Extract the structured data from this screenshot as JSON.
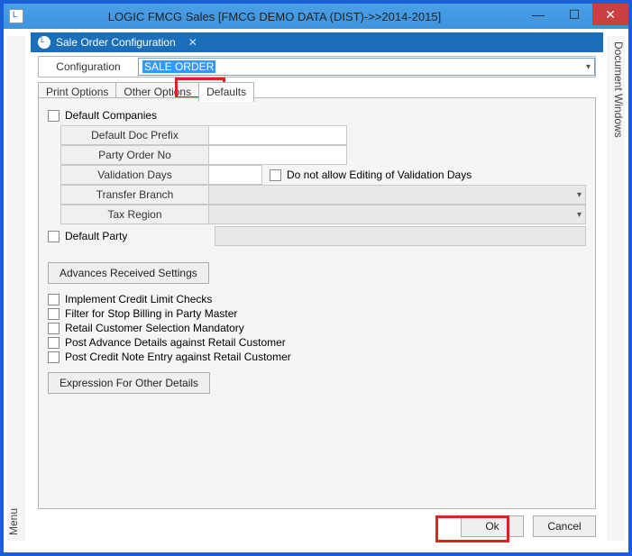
{
  "window": {
    "title": "LOGIC FMCG Sales  [FMCG DEMO DATA (DIST)->>2014-2015]"
  },
  "side": {
    "left": "Menu",
    "right": "Document Windows"
  },
  "docTab": {
    "title": "Sale Order Configuration",
    "close": "✕"
  },
  "configRow": {
    "label": "Configuration",
    "value": "SALE ORDER"
  },
  "tabs": {
    "print": "Print Options",
    "other": "Other Options",
    "defaults": "Defaults"
  },
  "form": {
    "defaultCompanies": "Default Companies",
    "docPrefix": "Default Doc Prefix",
    "partyOrderNo": "Party Order No",
    "validationDays": "Validation Days",
    "noEditValidation": "Do not allow Editing of Validation Days",
    "transferBranch": "Transfer Branch",
    "taxRegion": "Tax Region",
    "defaultParty": "Default Party"
  },
  "buttons": {
    "advances": "Advances Received Settings",
    "expression": "Expression For Other Details",
    "ok": "Ok",
    "cancel": "Cancel"
  },
  "checks": {
    "creditLimit": "Implement Credit Limit Checks",
    "stopBilling": "Filter for Stop Billing in Party Master",
    "retailMandatory": "Retail Customer Selection Mandatory",
    "postAdvance": "Post Advance Details against Retail Customer",
    "postCreditNote": "Post Credit Note Entry against Retail Customer"
  }
}
